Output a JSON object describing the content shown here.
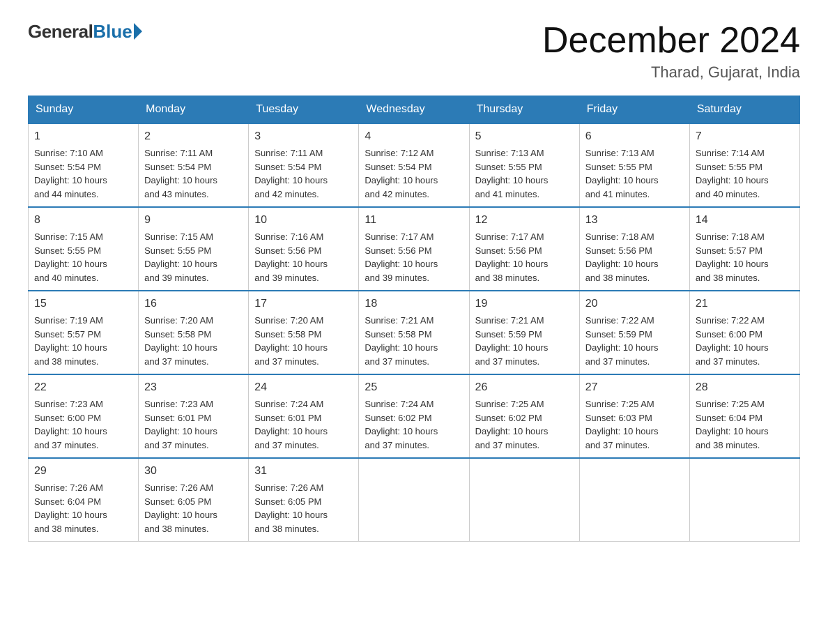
{
  "header": {
    "logo_general": "General",
    "logo_blue": "Blue",
    "month_title": "December 2024",
    "location": "Tharad, Gujarat, India"
  },
  "days_of_week": [
    "Sunday",
    "Monday",
    "Tuesday",
    "Wednesday",
    "Thursday",
    "Friday",
    "Saturday"
  ],
  "weeks": [
    [
      {
        "day": 1,
        "sunrise": "7:10 AM",
        "sunset": "5:54 PM",
        "daylight": "10 hours and 44 minutes."
      },
      {
        "day": 2,
        "sunrise": "7:11 AM",
        "sunset": "5:54 PM",
        "daylight": "10 hours and 43 minutes."
      },
      {
        "day": 3,
        "sunrise": "7:11 AM",
        "sunset": "5:54 PM",
        "daylight": "10 hours and 42 minutes."
      },
      {
        "day": 4,
        "sunrise": "7:12 AM",
        "sunset": "5:54 PM",
        "daylight": "10 hours and 42 minutes."
      },
      {
        "day": 5,
        "sunrise": "7:13 AM",
        "sunset": "5:55 PM",
        "daylight": "10 hours and 41 minutes."
      },
      {
        "day": 6,
        "sunrise": "7:13 AM",
        "sunset": "5:55 PM",
        "daylight": "10 hours and 41 minutes."
      },
      {
        "day": 7,
        "sunrise": "7:14 AM",
        "sunset": "5:55 PM",
        "daylight": "10 hours and 40 minutes."
      }
    ],
    [
      {
        "day": 8,
        "sunrise": "7:15 AM",
        "sunset": "5:55 PM",
        "daylight": "10 hours and 40 minutes."
      },
      {
        "day": 9,
        "sunrise": "7:15 AM",
        "sunset": "5:55 PM",
        "daylight": "10 hours and 39 minutes."
      },
      {
        "day": 10,
        "sunrise": "7:16 AM",
        "sunset": "5:56 PM",
        "daylight": "10 hours and 39 minutes."
      },
      {
        "day": 11,
        "sunrise": "7:17 AM",
        "sunset": "5:56 PM",
        "daylight": "10 hours and 39 minutes."
      },
      {
        "day": 12,
        "sunrise": "7:17 AM",
        "sunset": "5:56 PM",
        "daylight": "10 hours and 38 minutes."
      },
      {
        "day": 13,
        "sunrise": "7:18 AM",
        "sunset": "5:56 PM",
        "daylight": "10 hours and 38 minutes."
      },
      {
        "day": 14,
        "sunrise": "7:18 AM",
        "sunset": "5:57 PM",
        "daylight": "10 hours and 38 minutes."
      }
    ],
    [
      {
        "day": 15,
        "sunrise": "7:19 AM",
        "sunset": "5:57 PM",
        "daylight": "10 hours and 38 minutes."
      },
      {
        "day": 16,
        "sunrise": "7:20 AM",
        "sunset": "5:58 PM",
        "daylight": "10 hours and 37 minutes."
      },
      {
        "day": 17,
        "sunrise": "7:20 AM",
        "sunset": "5:58 PM",
        "daylight": "10 hours and 37 minutes."
      },
      {
        "day": 18,
        "sunrise": "7:21 AM",
        "sunset": "5:58 PM",
        "daylight": "10 hours and 37 minutes."
      },
      {
        "day": 19,
        "sunrise": "7:21 AM",
        "sunset": "5:59 PM",
        "daylight": "10 hours and 37 minutes."
      },
      {
        "day": 20,
        "sunrise": "7:22 AM",
        "sunset": "5:59 PM",
        "daylight": "10 hours and 37 minutes."
      },
      {
        "day": 21,
        "sunrise": "7:22 AM",
        "sunset": "6:00 PM",
        "daylight": "10 hours and 37 minutes."
      }
    ],
    [
      {
        "day": 22,
        "sunrise": "7:23 AM",
        "sunset": "6:00 PM",
        "daylight": "10 hours and 37 minutes."
      },
      {
        "day": 23,
        "sunrise": "7:23 AM",
        "sunset": "6:01 PM",
        "daylight": "10 hours and 37 minutes."
      },
      {
        "day": 24,
        "sunrise": "7:24 AM",
        "sunset": "6:01 PM",
        "daylight": "10 hours and 37 minutes."
      },
      {
        "day": 25,
        "sunrise": "7:24 AM",
        "sunset": "6:02 PM",
        "daylight": "10 hours and 37 minutes."
      },
      {
        "day": 26,
        "sunrise": "7:25 AM",
        "sunset": "6:02 PM",
        "daylight": "10 hours and 37 minutes."
      },
      {
        "day": 27,
        "sunrise": "7:25 AM",
        "sunset": "6:03 PM",
        "daylight": "10 hours and 37 minutes."
      },
      {
        "day": 28,
        "sunrise": "7:25 AM",
        "sunset": "6:04 PM",
        "daylight": "10 hours and 38 minutes."
      }
    ],
    [
      {
        "day": 29,
        "sunrise": "7:26 AM",
        "sunset": "6:04 PM",
        "daylight": "10 hours and 38 minutes."
      },
      {
        "day": 30,
        "sunrise": "7:26 AM",
        "sunset": "6:05 PM",
        "daylight": "10 hours and 38 minutes."
      },
      {
        "day": 31,
        "sunrise": "7:26 AM",
        "sunset": "6:05 PM",
        "daylight": "10 hours and 38 minutes."
      },
      null,
      null,
      null,
      null
    ]
  ],
  "labels": {
    "sunrise": "Sunrise:",
    "sunset": "Sunset:",
    "daylight": "Daylight:"
  }
}
